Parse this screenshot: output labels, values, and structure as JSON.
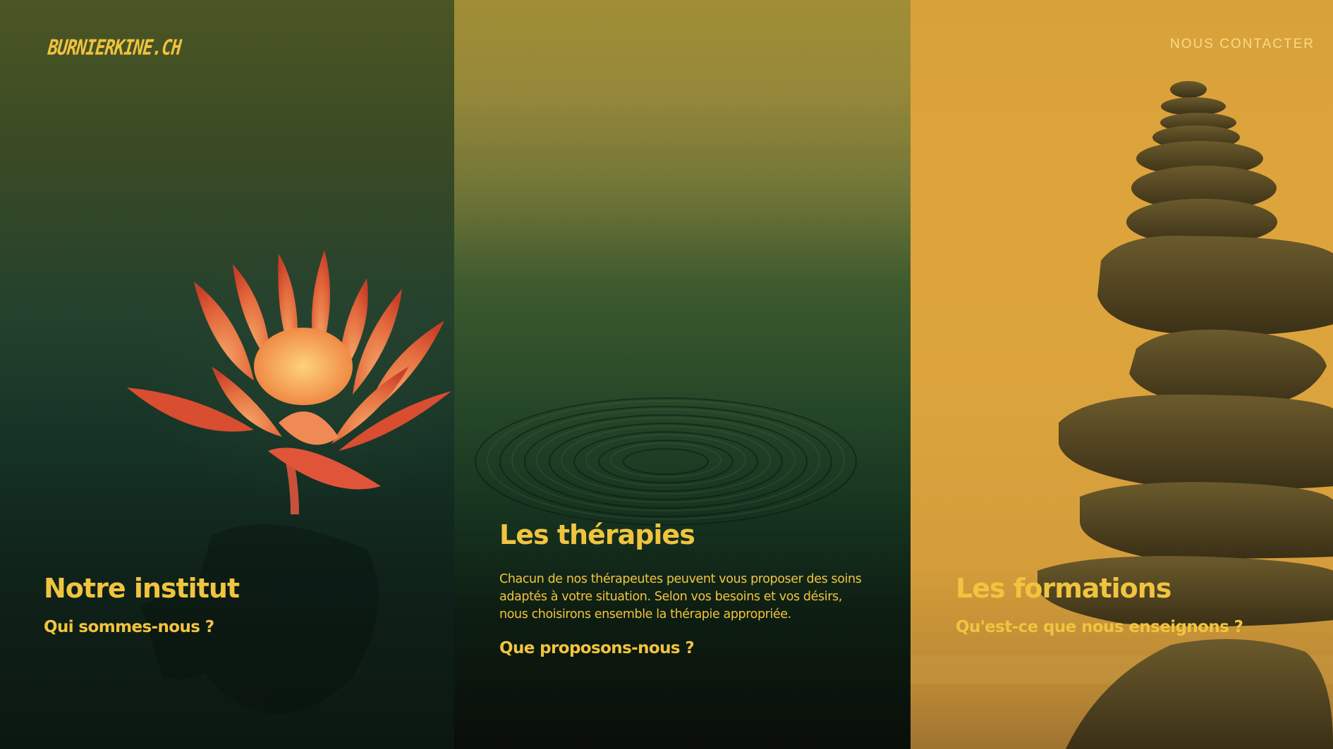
{
  "header": {
    "logo": "BURNIERKINE.CH",
    "contact": "NOUS CONTACTER"
  },
  "panels": [
    {
      "title": "Notre institut",
      "link": "Qui sommes-nous ?"
    },
    {
      "title": "Les thérapies",
      "description": "Chacun de nos thérapeutes peuvent vous proposer des soins adaptés à votre situation. Selon vos besoins et vos désirs, nous choisirons ensemble la thérapie appropriée.",
      "link": "Que proposons-nous ?"
    },
    {
      "title": "Les formations",
      "link": "Qu'est-ce que nous enseignons ?"
    }
  ],
  "colors": {
    "accent": "#f1c43f",
    "contact_text": "#f7dc8a",
    "panel_green": "#163326",
    "panel_olive": "#96883a",
    "panel_amber": "#dba33d"
  }
}
